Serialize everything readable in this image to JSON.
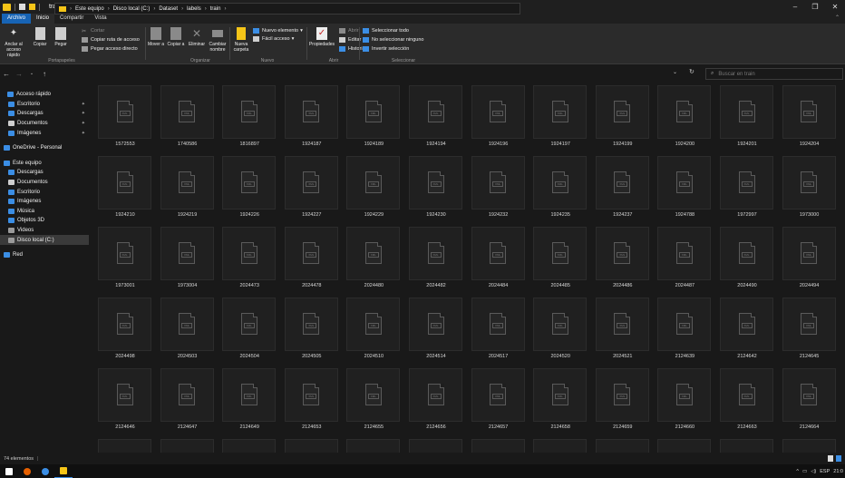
{
  "window": {
    "title": "train"
  },
  "ribbon_tabs": [
    "Archivo",
    "Inicio",
    "Compartir",
    "Vista"
  ],
  "ribbon": {
    "portapapeles": {
      "label": "Portapapeles",
      "pin": "Anclar al acceso rápido",
      "copy": "Copiar",
      "paste": "Pegar",
      "cut": "Cortar",
      "copy_path": "Copiar ruta de acceso",
      "paste_shortcut": "Pegar acceso directo"
    },
    "organizar": {
      "label": "Organizar",
      "move": "Mover a",
      "copy_to": "Copiar a",
      "delete": "Eliminar",
      "rename": "Cambiar nombre"
    },
    "nuevo": {
      "label": "Nuevo",
      "new_folder": "Nueva carpeta",
      "new_item": "Nuevo elemento",
      "easy_access": "Fácil acceso"
    },
    "abrir": {
      "label": "Abrir",
      "properties": "Propiedades",
      "open": "Abrir",
      "edit": "Editar",
      "history": "Historial"
    },
    "seleccionar": {
      "label": "Seleccionar",
      "select_all": "Seleccionar todo",
      "select_none": "No seleccionar ninguno",
      "invert": "Invertir selección"
    }
  },
  "address": {
    "crumbs": [
      "Este equipo",
      "Disco local (C:)",
      "Dataset",
      "labels",
      "train"
    ],
    "search_placeholder": "Buscar en train"
  },
  "sidebar": [
    {
      "label": "Acceso rápido",
      "icon": "star-icon",
      "color": "#3b8ee5",
      "pinned": false
    },
    {
      "label": "Escritorio",
      "icon": "desktop-icon",
      "color": "#3b8ee5",
      "pinned": true
    },
    {
      "label": "Descargas",
      "icon": "download-icon",
      "color": "#3b8ee5",
      "pinned": true
    },
    {
      "label": "Documentos",
      "icon": "document-icon",
      "color": "#cfcfcf",
      "pinned": true
    },
    {
      "label": "Imágenes",
      "icon": "image-icon",
      "color": "#3b8ee5",
      "pinned": true
    },
    {
      "label": "OneDrive - Personal",
      "icon": "cloud-icon",
      "color": "#3b8ee5",
      "pinned": false
    },
    {
      "label": "Este equipo",
      "icon": "computer-icon",
      "color": "#3b8ee5",
      "pinned": false
    },
    {
      "label": "Descargas",
      "icon": "download-icon",
      "color": "#3b8ee5",
      "pinned": false
    },
    {
      "label": "Documentos",
      "icon": "document-icon",
      "color": "#cfcfcf",
      "pinned": false
    },
    {
      "label": "Escritorio",
      "icon": "desktop-icon",
      "color": "#3b8ee5",
      "pinned": false
    },
    {
      "label": "Imágenes",
      "icon": "image-icon",
      "color": "#3b8ee5",
      "pinned": false
    },
    {
      "label": "Música",
      "icon": "music-icon",
      "color": "#3b8ee5",
      "pinned": false
    },
    {
      "label": "Objetos 3D",
      "icon": "cube-icon",
      "color": "#3b8ee5",
      "pinned": false
    },
    {
      "label": "Videos",
      "icon": "video-icon",
      "color": "#9a9a9a",
      "pinned": false
    },
    {
      "label": "Disco local (C:)",
      "icon": "drive-icon",
      "color": "#9a9a9a",
      "pinned": false,
      "selected": true
    },
    {
      "label": "Red",
      "icon": "network-icon",
      "color": "#3b8ee5",
      "pinned": false
    }
  ],
  "files": [
    "1572553",
    "1740586",
    "1816897",
    "1924187",
    "1924189",
    "1924194",
    "1924196",
    "1924197",
    "1924199",
    "1924200",
    "1924201",
    "1924204",
    "1924210",
    "1924219",
    "1924226",
    "1924227",
    "1924229",
    "1924230",
    "1924232",
    "1924235",
    "1924237",
    "1924788",
    "1972997",
    "1973000",
    "1973001",
    "1973004",
    "2024473",
    "2024478",
    "2024480",
    "2024482",
    "2024484",
    "2024485",
    "2024486",
    "2024487",
    "2024490",
    "2024494",
    "2024498",
    "2024503",
    "2024504",
    "2024505",
    "2024510",
    "2024514",
    "2024517",
    "2024520",
    "2024521",
    "2124639",
    "2124642",
    "2124645",
    "2124646",
    "2124647",
    "2124649",
    "2124653",
    "2124655",
    "2124656",
    "2124657",
    "2124658",
    "2124659",
    "2124660",
    "2124663",
    "2124664",
    "",
    "",
    "",
    "",
    "",
    "",
    "",
    "",
    "",
    "",
    "",
    ""
  ],
  "file_type_label": "XML",
  "status": {
    "count": "74 elementos"
  },
  "tray": {
    "lang": "ESP",
    "time": "21:0"
  },
  "colors": {
    "accent": "#1764b5",
    "folder": "#f5c518"
  }
}
